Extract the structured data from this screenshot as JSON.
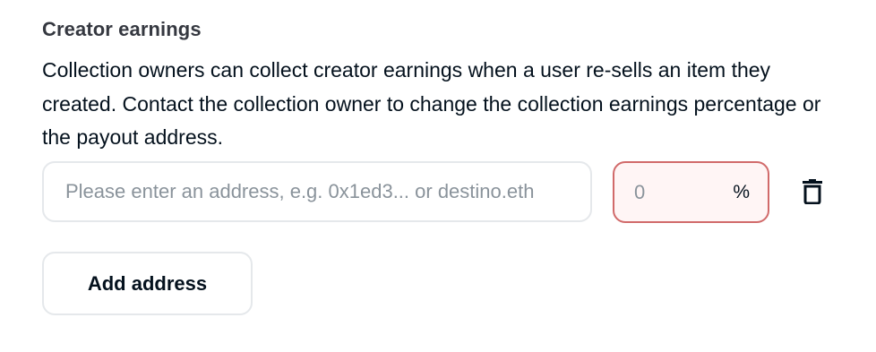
{
  "creator_earnings": {
    "title": "Creator earnings",
    "description": "Collection owners can collect creator earnings when a user re-sells an item they created. Contact the collection owner to change the collection earnings percentage or the payout address.",
    "address_field": {
      "value": "",
      "placeholder": "Please enter an address, e.g. 0x1ed3... or destino.eth"
    },
    "percentage_field": {
      "value": "",
      "placeholder": "0",
      "suffix": "%",
      "state": "error",
      "error_border_color": "#d16a6a",
      "error_background_color": "#fff5f5"
    },
    "delete_icon": "trash-icon",
    "add_address_label": "Add address"
  }
}
